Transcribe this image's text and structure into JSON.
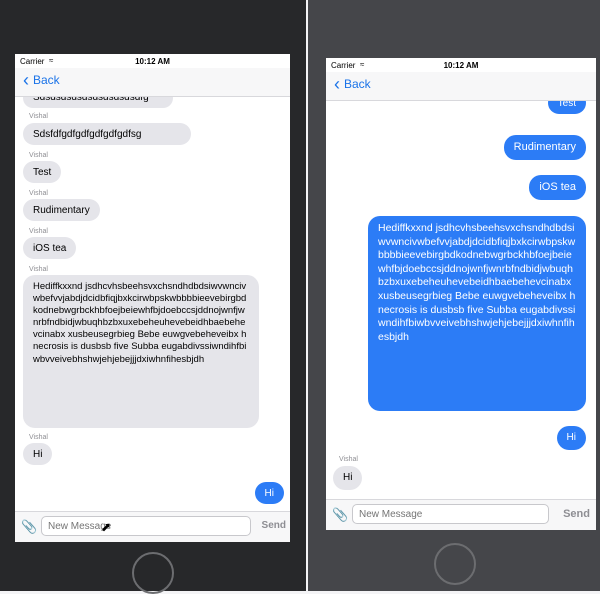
{
  "left": {
    "status": {
      "carrier": "Carrier",
      "time": "10:12 AM"
    },
    "nav": {
      "back": "Back"
    },
    "messages": [
      {
        "sender": "",
        "text": "Sdsdsdsdsdsdsdsdsdsdfg",
        "dir": "in"
      },
      {
        "sender": "Vishal",
        "text": "Sdsfdfgdfgdfgdfgdfgdfsg",
        "dir": "in"
      },
      {
        "sender": "Vishal",
        "text": "Test",
        "dir": "in"
      },
      {
        "sender": "Vishal",
        "text": "Rudimentary",
        "dir": "in"
      },
      {
        "sender": "Vishal",
        "text": "iOS tea",
        "dir": "in"
      },
      {
        "sender": "Vishal",
        "text": "Hediffkxxnd jsdhcvhsbeehsvxchsndhdbdsiwvwncivwbefvvjabdjdcidbfiqjbxkcirwbpskwbbbbieevebirgbdkodnebwgrbckhbfoejbeiewhfbjdoebccsjddnojwnfjwnrbfndbidjwbuqhbzbxuxebeheuhevebeidhbaebehevcinabx xusbeusegrbieg Bebe euwgvebeheveibx h necrosis is dusbsb five Subba eugabdivssiwndihfbiwbvveivebhshwjehjebejjjdxiwhnfihesbjdh",
        "dir": "in"
      },
      {
        "sender": "Vishal",
        "text": "Hi",
        "dir": "in"
      },
      {
        "sender": "",
        "text": "Hi",
        "dir": "out"
      }
    ],
    "input": {
      "placeholder": "New Message",
      "send": "Send"
    }
  },
  "right": {
    "status": {
      "carrier": "Carrier",
      "time": "10:12 AM"
    },
    "nav": {
      "back": "Back"
    },
    "messages": [
      {
        "sender": "",
        "text": "Test",
        "dir": "out"
      },
      {
        "sender": "",
        "text": "Rudimentary",
        "dir": "out"
      },
      {
        "sender": "",
        "text": "iOS tea",
        "dir": "out"
      },
      {
        "sender": "",
        "text": "Hediffkxxnd jsdhcvhsbeehsvxchsndhdbdsiwvwncivwbefvvjabdjdcidbfiqjbxkcirwbpskwbbbbieevebirgbdkodnebwgrbckhbfoejbeiewhfbjdoebccsjddnojwnfjwnrbfndbidjwbuqhbzbxuxebeheuhevebeidhbaebehevcinabx xusbeusegrbieg Bebe euwgvebeheveibx h necrosis is dusbsb five Subba eugabdivssiwndihfbiwbvveivebhshwjehjebejjjdxiwhnfihesbjdh",
        "dir": "out"
      },
      {
        "sender": "",
        "text": "Hi",
        "dir": "out"
      },
      {
        "sender": "Vishal",
        "text": "Hi",
        "dir": "in"
      }
    ],
    "input": {
      "placeholder": "New Message",
      "send": "Send"
    }
  },
  "icons": {
    "wifi": "wifi-icon",
    "back": "chevron-left-icon",
    "attach": "paperclip-icon",
    "cursor": "mouse-pointer-icon"
  },
  "colors": {
    "outgoing": "#2c7cf6",
    "incoming": "#e5e5ea",
    "tint": "#1a73e8"
  }
}
